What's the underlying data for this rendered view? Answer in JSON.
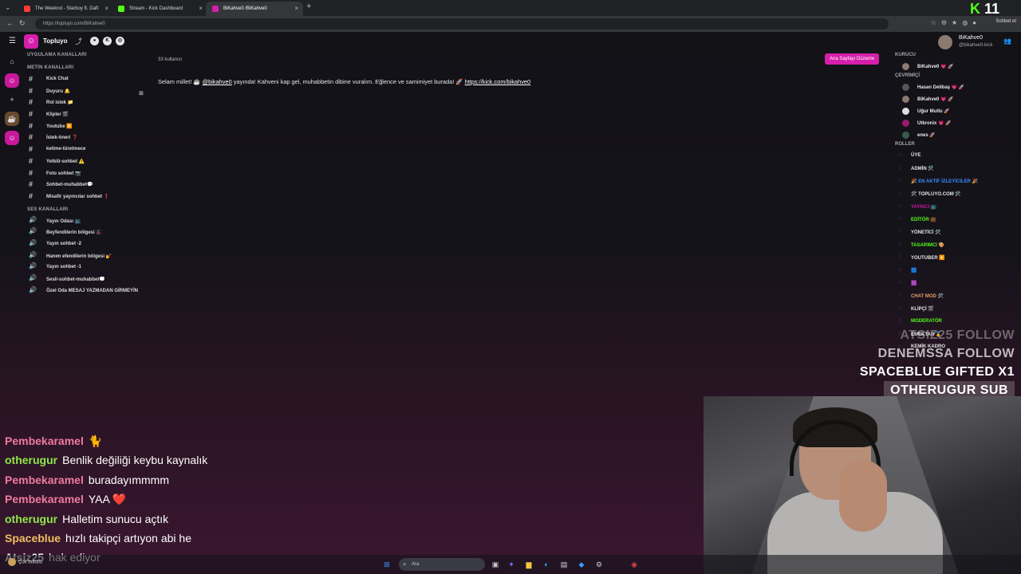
{
  "browser": {
    "tabs": [
      {
        "title": "The Weeknd - Starboy ft. Daft",
        "fav_color": "#ff3b3b",
        "active": false
      },
      {
        "title": "Stream - Kick Dashboard",
        "fav_color": "#53fc18",
        "active": false
      },
      {
        "title": "BiKahve0 /BiKahve0",
        "fav_color": "#d51faa",
        "active": true
      }
    ],
    "url": "https://topluyo.com/BiKahve0",
    "chat_button": "Sohbet et",
    "badge_k": "K",
    "badge_num": "11"
  },
  "app": {
    "brand": "Topluyo",
    "user_count": "33 kullanıcı",
    "edit_button": "Ana Sayfayı Düzenle",
    "message": {
      "prefix": "Selam millet! ☕",
      "mention": "@bikahve0",
      "body": "yayında! Kahveni kap gel, muhabbetin dibine vuralım. Eğlence ve samimiyet burada! 🚀",
      "link": "https://kick.com/bikahve0"
    },
    "current_user": {
      "name": "BiKahve0",
      "handle": "@bikahve0-kick"
    }
  },
  "sidebar": {
    "app_channels_header": "UYGULAMA KANALLARI",
    "text_channels_header": "METİN KANALLARI",
    "text_channels": [
      "Kick Chat",
      "Duyuru 🔔",
      "Rol istek 📁",
      "Klipler 🎬",
      "Youtube ▶️",
      "İstek-öneri ❓",
      "kelime-türetmece",
      "Yetkili-sohbet ⚠️",
      "Foto sohbet 📷",
      "Sohbet-muhabbet💬",
      "Misafir yayıncılar sohbet ❗"
    ],
    "voice_channels_header": "SES KANALLARI",
    "voice_channels": [
      "Yayın Odası 📺",
      "Beyfendilerin bölgesi 🎩",
      "Yayın sohbet -2",
      "Hanım efendilerin bölgesi 💅",
      "Yayın sohbet -1",
      "Sesli-sohbet-muhabbet💭",
      "Özel Oda MESAJ YAZMADAN GİRMEYİN"
    ]
  },
  "right_panel": {
    "founder_header": "KURUCU",
    "founders": [
      {
        "name": "BiKahve0 💗 🚀",
        "color": "#8a7a70"
      }
    ],
    "online_header": "ÇEVRİMİÇİ",
    "online": [
      {
        "name": "Hasan Delibaş 💗 🚀",
        "color": "#555"
      },
      {
        "name": "BiKahve0 💗 🚀",
        "color": "#8a7a70"
      },
      {
        "name": "Uğur Mutlu 🚀",
        "color": "#ddd"
      },
      {
        "name": "Utkronix 💗 🚀",
        "color": "#9b1a6e"
      },
      {
        "name": "enes 🚀",
        "color": "#3a5a4a"
      }
    ],
    "roles_header": "ROLLER",
    "roles": [
      {
        "name": "ÜYE",
        "color": "#e6e6e6"
      },
      {
        "name": "ADMİN 🛠️",
        "color": "#e6e6e6"
      },
      {
        "name": "🎉 EN AKTİF İZLEYİCİLER 🎉",
        "color": "#3b8cff"
      },
      {
        "name": "🛠️ TOPLUYO.COM 🛠️",
        "color": "#e6e6e6"
      },
      {
        "name": "YAYINCI 📺",
        "color": "#c8189b"
      },
      {
        "name": "EDİTÖR 💼",
        "color": "#53fc18"
      },
      {
        "name": "YÖNETİCİ 🛠️",
        "color": "#e6e6e6"
      },
      {
        "name": "TASARIMCI 🎨",
        "color": "#53fc18"
      },
      {
        "name": "YOUTUBER ▶️",
        "color": "#e6e6e6"
      },
      {
        "name": "🟦",
        "color": "#3b8cff"
      },
      {
        "name": "🟪",
        "color": "#e0559e"
      },
      {
        "name": "CHAT MOD 🛠️",
        "color": "#e5a06a"
      },
      {
        "name": "KLİPÇİ 🎬",
        "color": "#e6e6e6"
      },
      {
        "name": "MODERATÖR",
        "color": "#53fc18"
      },
      {
        "name": "EMEKTAR 🏅",
        "color": "#e6e6e6"
      },
      {
        "name": "KEMİK KADRO",
        "color": "#e6e6e6"
      }
    ]
  },
  "stream": {
    "alerts": [
      {
        "text": "ATSIZ25 FOLLOW",
        "style": "faded"
      },
      {
        "text": "DENEMSSA FOLLOW",
        "style": "mid"
      },
      {
        "text": "SPACEBLUE GIFTED X1",
        "style": "full"
      },
      {
        "text": "OTHERUGUR SUB",
        "style": "boxed"
      }
    ],
    "chat": [
      {
        "user": "Pembekaramel",
        "msg": "🐈",
        "color": "#f07aa0"
      },
      {
        "user": "otherugur",
        "msg": "Benlik değiliği keybu kaynalık",
        "color": "#8fe84a"
      },
      {
        "user": "Pembekaramel",
        "msg": "buradayımmmm",
        "color": "#f07aa0"
      },
      {
        "user": "Pembekaramel",
        "msg": "YAA ❤️",
        "color": "#f07aa0"
      },
      {
        "user": "otherugur",
        "msg": "Halletim sunucu açtık",
        "color": "#8fe84a"
      },
      {
        "user": "Spaceblue",
        "msg": "hızlı takipçi artıyon abi he",
        "color": "#f0c060"
      },
      {
        "user": "Atsiz25",
        "msg": "hak ediyor",
        "color": "#ffffff"
      }
    ]
  },
  "taskbar": {
    "weather": "Çok bulutlu",
    "search_placeholder": "Ara"
  }
}
